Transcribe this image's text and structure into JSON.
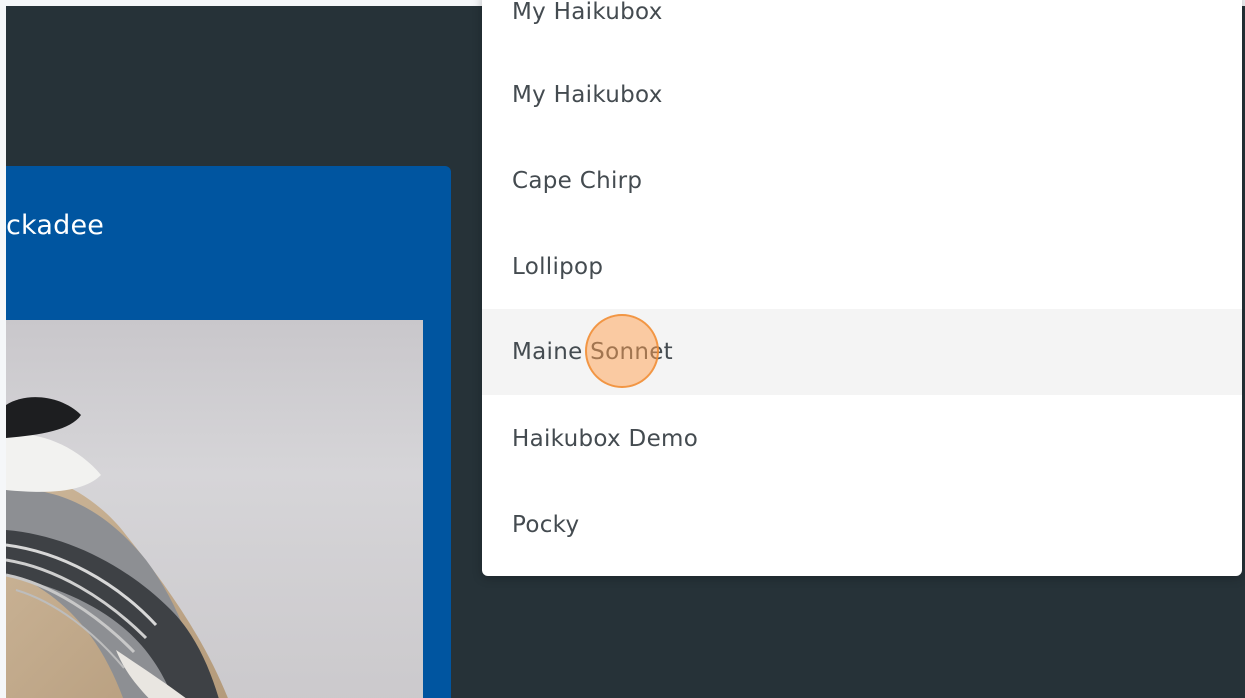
{
  "bird_card": {
    "name_fragment": "ckadee"
  },
  "dropdown": {
    "items": [
      {
        "label": "My Haikubox"
      },
      {
        "label": "My Haikubox"
      },
      {
        "label": "Cape Chirp"
      },
      {
        "label": "Lollipop"
      },
      {
        "label": "Maine Sonnet"
      },
      {
        "label": "Haikubox Demo"
      },
      {
        "label": "Pocky"
      }
    ],
    "hovered_item": "Maine Sonnet"
  },
  "colors": {
    "app_background": "#263238",
    "card_blue": "#0055a0",
    "menu_background": "#ffffff",
    "menu_hover": "#f4f4f4",
    "menu_text": "#444b50",
    "click_marker": "#f5a05a"
  }
}
